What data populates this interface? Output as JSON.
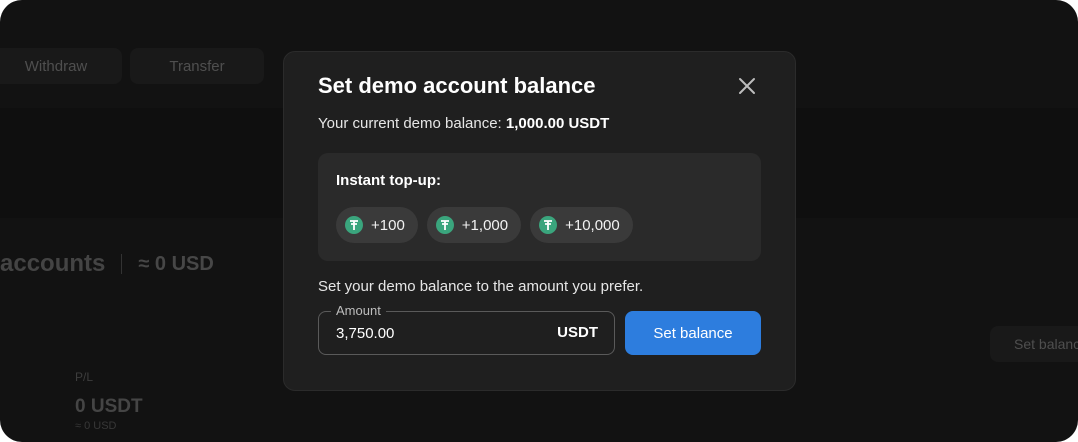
{
  "background": {
    "withdraw_label": "Withdraw",
    "transfer_label": "Transfer",
    "section_title": "accounts",
    "section_total": "≈ 0 USD",
    "set_balance_label": "Set balance",
    "pl_label": "P/L",
    "pl_value": "0 USDT",
    "pl_sub": "≈ 0 USD"
  },
  "modal": {
    "title": "Set demo account balance",
    "close_icon": "close-icon",
    "balance_prefix": "Your current demo balance:",
    "balance_amount": "1,000.00 USDT",
    "topup": {
      "label": "Instant top-up:",
      "chips": [
        {
          "label": "+100",
          "icon": "tether-icon"
        },
        {
          "label": "+1,000",
          "icon": "tether-icon"
        },
        {
          "label": "+10,000",
          "icon": "tether-icon"
        }
      ]
    },
    "prefer_text": "Set your demo balance to the amount you prefer.",
    "amount": {
      "legend": "Amount",
      "value": "3,750.00",
      "unit": "USDT"
    },
    "submit_label": "Set balance"
  },
  "colors": {
    "accent": "#2d7dde",
    "tether": "#3aa57d",
    "modal_bg": "#1f1f1f",
    "box_bg": "#2a2a2a"
  }
}
